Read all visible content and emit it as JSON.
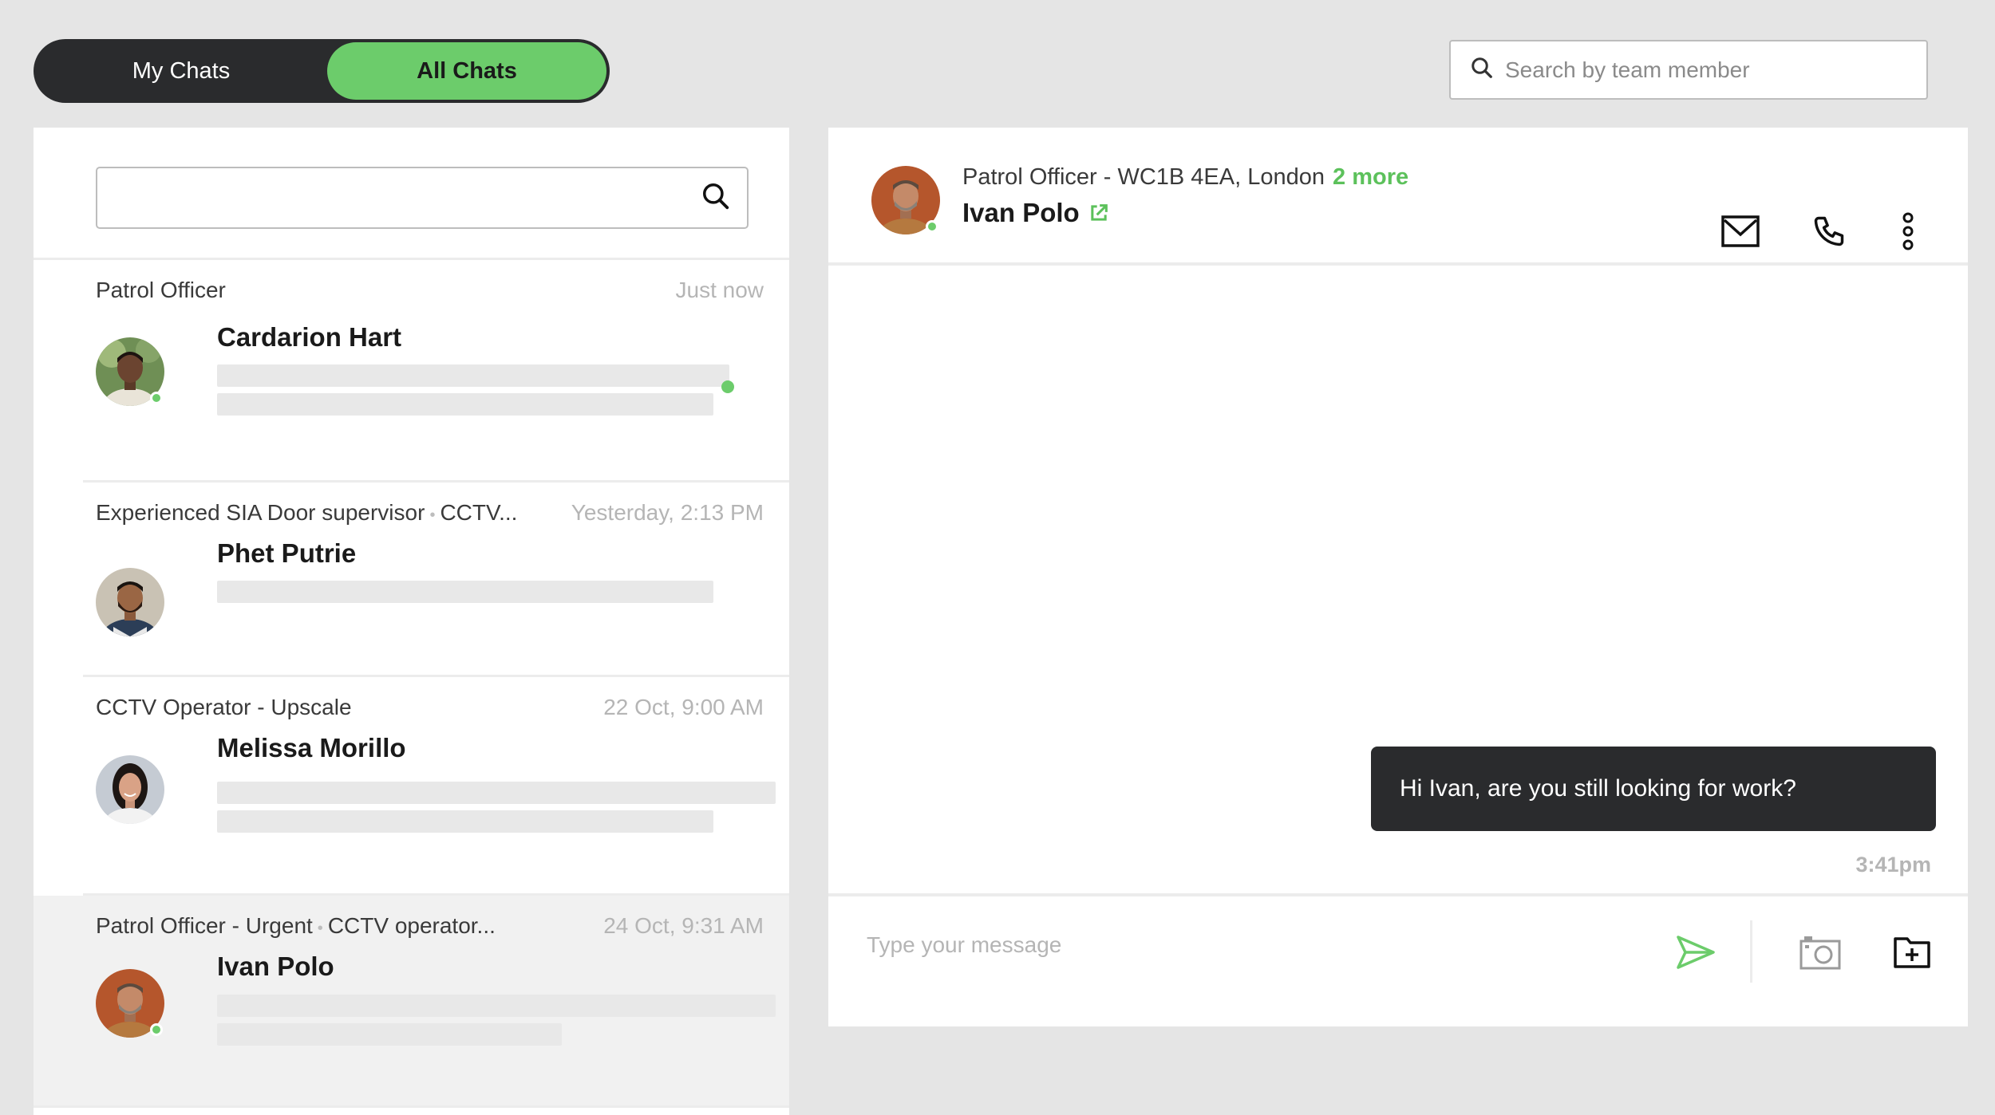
{
  "tabs": {
    "my_chats": "My Chats",
    "all_chats": "All Chats",
    "selected": "All Chats"
  },
  "top_search": {
    "placeholder": "Search by team member",
    "value": ""
  },
  "left_search": {
    "placeholder": "",
    "value": ""
  },
  "chats": [
    {
      "role_parts": [
        "Patrol Officer"
      ],
      "time": "Just now",
      "name": "Cardarion Hart",
      "online": true,
      "unread": true,
      "avatar": "avatar-cardarion"
    },
    {
      "role_parts": [
        "Experienced SIA Door supervisor",
        "CCTV..."
      ],
      "time": "Yesterday, 2:13 PM",
      "name": "Phet Putrie",
      "online": false,
      "unread": false,
      "avatar": "avatar-phet"
    },
    {
      "role_parts": [
        "CCTV Operator - Upscale"
      ],
      "time": "22 Oct, 9:00 AM",
      "name": "Melissa Morillo",
      "online": false,
      "unread": false,
      "avatar": "avatar-melissa"
    },
    {
      "role_parts": [
        "Patrol Officer  -  Urgent",
        "CCTV operator..."
      ],
      "time": "24 Oct, 9:31 AM",
      "name": "Ivan Polo",
      "online": true,
      "unread": false,
      "active": true,
      "avatar": "avatar-ivan"
    }
  ],
  "conversation": {
    "role": "Patrol Officer - WC1B 4EA, London",
    "more": "2 more",
    "name": "Ivan Polo",
    "online": true,
    "actions": [
      "mail-icon",
      "phone-icon",
      "more-vertical-icon"
    ]
  },
  "messages": [
    {
      "text": "Hi Ivan, are you still looking for work?",
      "time": "3:41pm",
      "outgoing": true
    }
  ],
  "composer": {
    "placeholder": "Type your message",
    "value": "",
    "actions": [
      "send-icon",
      "camera-icon",
      "folder-add-icon"
    ]
  },
  "colors": {
    "accent": "#6ccc6b",
    "dark": "#2a2b2d",
    "background": "#e5e5e5",
    "online": "#6ccc6b"
  }
}
